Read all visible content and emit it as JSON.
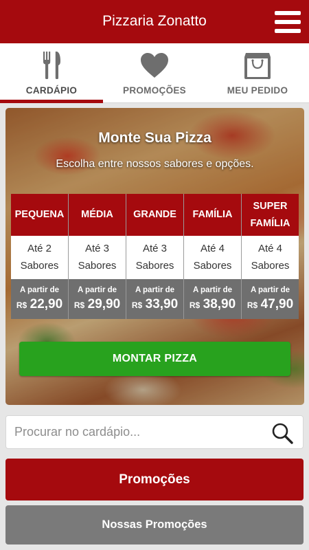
{
  "app": {
    "title": "Pizzaria Zonatto"
  },
  "tabs": [
    {
      "label": "CARDÁPIO",
      "icon": "fork-knife-icon",
      "active": true
    },
    {
      "label": "PROMOÇÕES",
      "icon": "heart-icon",
      "active": false
    },
    {
      "label": "MEU PEDIDO",
      "icon": "shopping-bag-icon",
      "active": false
    }
  ],
  "hero": {
    "title": "Monte Sua Pizza",
    "subtitle": "Escolha entre nossos sabores e opções.",
    "sizes": [
      {
        "name": "PEQUENA",
        "flavors_line1": "Até 2",
        "flavors_line2": "Sabores",
        "price_label": "A partir de",
        "currency": "R$",
        "price": "22,90"
      },
      {
        "name": "MÉDIA",
        "flavors_line1": "Até 3",
        "flavors_line2": "Sabores",
        "price_label": "A partir de",
        "currency": "R$",
        "price": "29,90"
      },
      {
        "name": "GRANDE",
        "flavors_line1": "Até 3",
        "flavors_line2": "Sabores",
        "price_label": "A partir de",
        "currency": "R$",
        "price": "33,90"
      },
      {
        "name": "FAMÍLIA",
        "flavors_line1": "Até 4",
        "flavors_line2": "Sabores",
        "price_label": "A partir de",
        "currency": "R$",
        "price": "38,90"
      },
      {
        "name": "SUPER FAMÍLIA",
        "flavors_line1": "Até 4",
        "flavors_line2": "Sabores",
        "price_label": "A partir de",
        "currency": "R$",
        "price": "47,90"
      }
    ],
    "button_label": "MONTAR PIZZA"
  },
  "search": {
    "placeholder": "Procurar no cardápio...",
    "value": ""
  },
  "promo_button": "Promoções",
  "nossas_button": "Nossas Promoções",
  "colors": {
    "brand_red": "#a50a0e",
    "green": "#28a21e",
    "gray": "#7a7a7a"
  }
}
